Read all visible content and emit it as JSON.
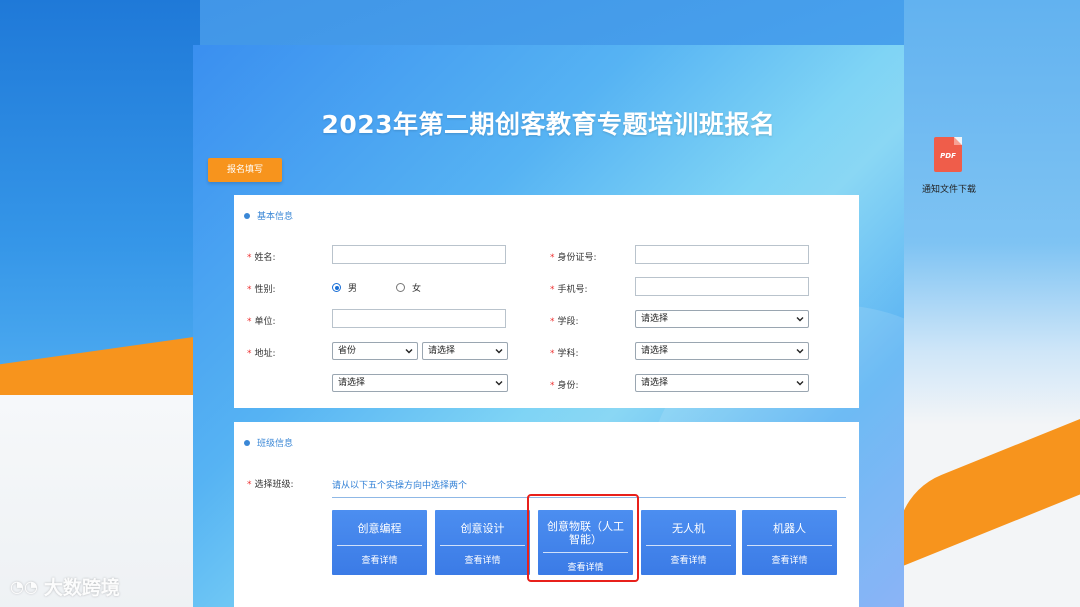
{
  "page": {
    "title": "2023年第二期创客教育专题培训班报名",
    "tab_label": "报名填写"
  },
  "basic": {
    "section_title": "基本信息",
    "name_label": "姓名:",
    "gender_label": "性别:",
    "gender_options": [
      "男",
      "女"
    ],
    "gender_selected": "男",
    "unit_label": "单位:",
    "address_label": "地址:",
    "address_province": "省份",
    "address_city": "请选择",
    "address_district": "请选择",
    "id_label": "身份证号:",
    "phone_label": "手机号:",
    "stage_label": "学段:",
    "stage_value": "请选择",
    "subject_label": "学科:",
    "subject_value": "请选择",
    "identity_label": "身份:",
    "identity_value": "请选择"
  },
  "class_info": {
    "section_title": "班级信息",
    "select_label": "选择班级:",
    "hint": "请从以下五个实操方向中选择两个",
    "courses": [
      {
        "name": "创意编程",
        "detail": "查看详情"
      },
      {
        "name": "创意设计",
        "detail": "查看详情"
      },
      {
        "name": "创意物联（人工智能）",
        "detail": "查看详情"
      },
      {
        "name": "无人机",
        "detail": "查看详情"
      },
      {
        "name": "机器人",
        "detail": "查看详情"
      }
    ]
  },
  "download": {
    "icon_text": "PDF",
    "label": "通知文件下载"
  },
  "watermark": {
    "text": "大数跨境"
  },
  "colors": {
    "accent": "#3a87d6",
    "orange": "#f7941d",
    "course_blue": "#4c8ef0",
    "highlight": "#e8201b",
    "required": "#e33"
  }
}
